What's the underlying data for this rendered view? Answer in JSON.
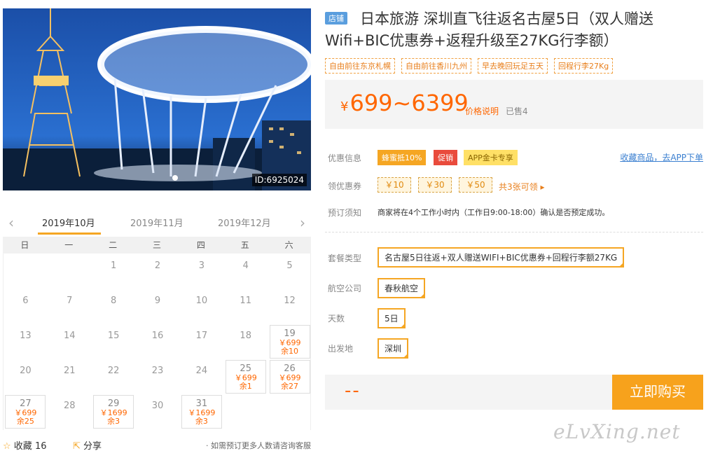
{
  "hero": {
    "id_label": "ID:6925024"
  },
  "calendar": {
    "prev_icon": "chevron-left-icon",
    "next_icon": "chevron-right-icon",
    "months": [
      "2019年10月",
      "2019年11月",
      "2019年12月"
    ],
    "weekdays": [
      "日",
      "一",
      "二",
      "三",
      "四",
      "五",
      "六"
    ],
    "days": [
      {
        "day": "1",
        "col": 2,
        "row": 0
      },
      {
        "day": "2",
        "col": 3,
        "row": 0
      },
      {
        "day": "3",
        "col": 4,
        "row": 0
      },
      {
        "day": "4",
        "col": 5,
        "row": 0
      },
      {
        "day": "5",
        "col": 6,
        "row": 0
      },
      {
        "day": "6",
        "col": 0,
        "row": 1
      },
      {
        "day": "7",
        "col": 1,
        "row": 1
      },
      {
        "day": "8",
        "col": 2,
        "row": 1
      },
      {
        "day": "9",
        "col": 3,
        "row": 1
      },
      {
        "day": "10",
        "col": 4,
        "row": 1
      },
      {
        "day": "11",
        "col": 5,
        "row": 1
      },
      {
        "day": "12",
        "col": 6,
        "row": 1
      },
      {
        "day": "13",
        "col": 0,
        "row": 2
      },
      {
        "day": "14",
        "col": 1,
        "row": 2
      },
      {
        "day": "15",
        "col": 2,
        "row": 2
      },
      {
        "day": "16",
        "col": 3,
        "row": 2
      },
      {
        "day": "17",
        "col": 4,
        "row": 2
      },
      {
        "day": "18",
        "col": 5,
        "row": 2
      },
      {
        "day": "19",
        "col": 6,
        "row": 2,
        "price": "￥699",
        "stock": "余10"
      },
      {
        "day": "20",
        "col": 0,
        "row": 3
      },
      {
        "day": "21",
        "col": 1,
        "row": 3
      },
      {
        "day": "22",
        "col": 2,
        "row": 3
      },
      {
        "day": "23",
        "col": 3,
        "row": 3
      },
      {
        "day": "24",
        "col": 4,
        "row": 3
      },
      {
        "day": "25",
        "col": 5,
        "row": 3,
        "price": "￥699",
        "stock": "余1"
      },
      {
        "day": "26",
        "col": 6,
        "row": 3,
        "price": "￥699",
        "stock": "余27"
      },
      {
        "day": "27",
        "col": 0,
        "row": 4,
        "price": "￥699",
        "stock": "余25"
      },
      {
        "day": "28",
        "col": 1,
        "row": 4
      },
      {
        "day": "29",
        "col": 2,
        "row": 4,
        "price": "￥1699",
        "stock": "余3"
      },
      {
        "day": "30",
        "col": 3,
        "row": 4
      },
      {
        "day": "31",
        "col": 4,
        "row": 4,
        "price": "￥1699",
        "stock": "余3"
      }
    ]
  },
  "actions": {
    "favorite_label": "收藏",
    "favorite_count": "16",
    "share_label": "分享",
    "tip": "· 如需预订更多人数请咨询客服"
  },
  "product": {
    "shop_badge": "店铺",
    "title": "日本旅游 深圳直飞往返名古屋5日（双人赠送Wifi+BIC优惠券+返程升级至27KG行李额）",
    "tags": [
      "自由前往东京札幌",
      "自由前往香川九州",
      "早去晚回玩足五天",
      "回程行李27Kg"
    ],
    "price_symbol": "¥",
    "price": "699~6399",
    "price_note": "价格说明",
    "sold": "已售4"
  },
  "promo": {
    "label": "优惠信息",
    "chips": [
      "蜂蜜抵10%",
      "促销",
      "APP金卡专享"
    ],
    "collect_link": "收藏商品，去APP下单"
  },
  "coupons": {
    "label": "领优惠券",
    "items": [
      "￥10",
      "￥30",
      "￥50"
    ],
    "more": "共3张可领 ▸"
  },
  "notice": {
    "label": "预订须知",
    "text": "商家将在4个工作小时内（工作日9:00-18:00）确认是否预定成功。"
  },
  "options": {
    "package_label": "套餐类型",
    "package_value": "名古屋5日往返+双人赠送WIFI+BIC优惠券+回程行李额27KG",
    "airline_label": "航空公司",
    "airline_value": "春秋航空",
    "days_label": "天数",
    "days_value": "5日",
    "depart_label": "出发地",
    "depart_value": "深圳"
  },
  "purchase": {
    "total": "--",
    "buy_label": "立即购买"
  },
  "watermark": "eLvXing.net",
  "colors": {
    "accent": "#f5a623",
    "price": "#ff6600",
    "link": "#3a7fd0"
  }
}
